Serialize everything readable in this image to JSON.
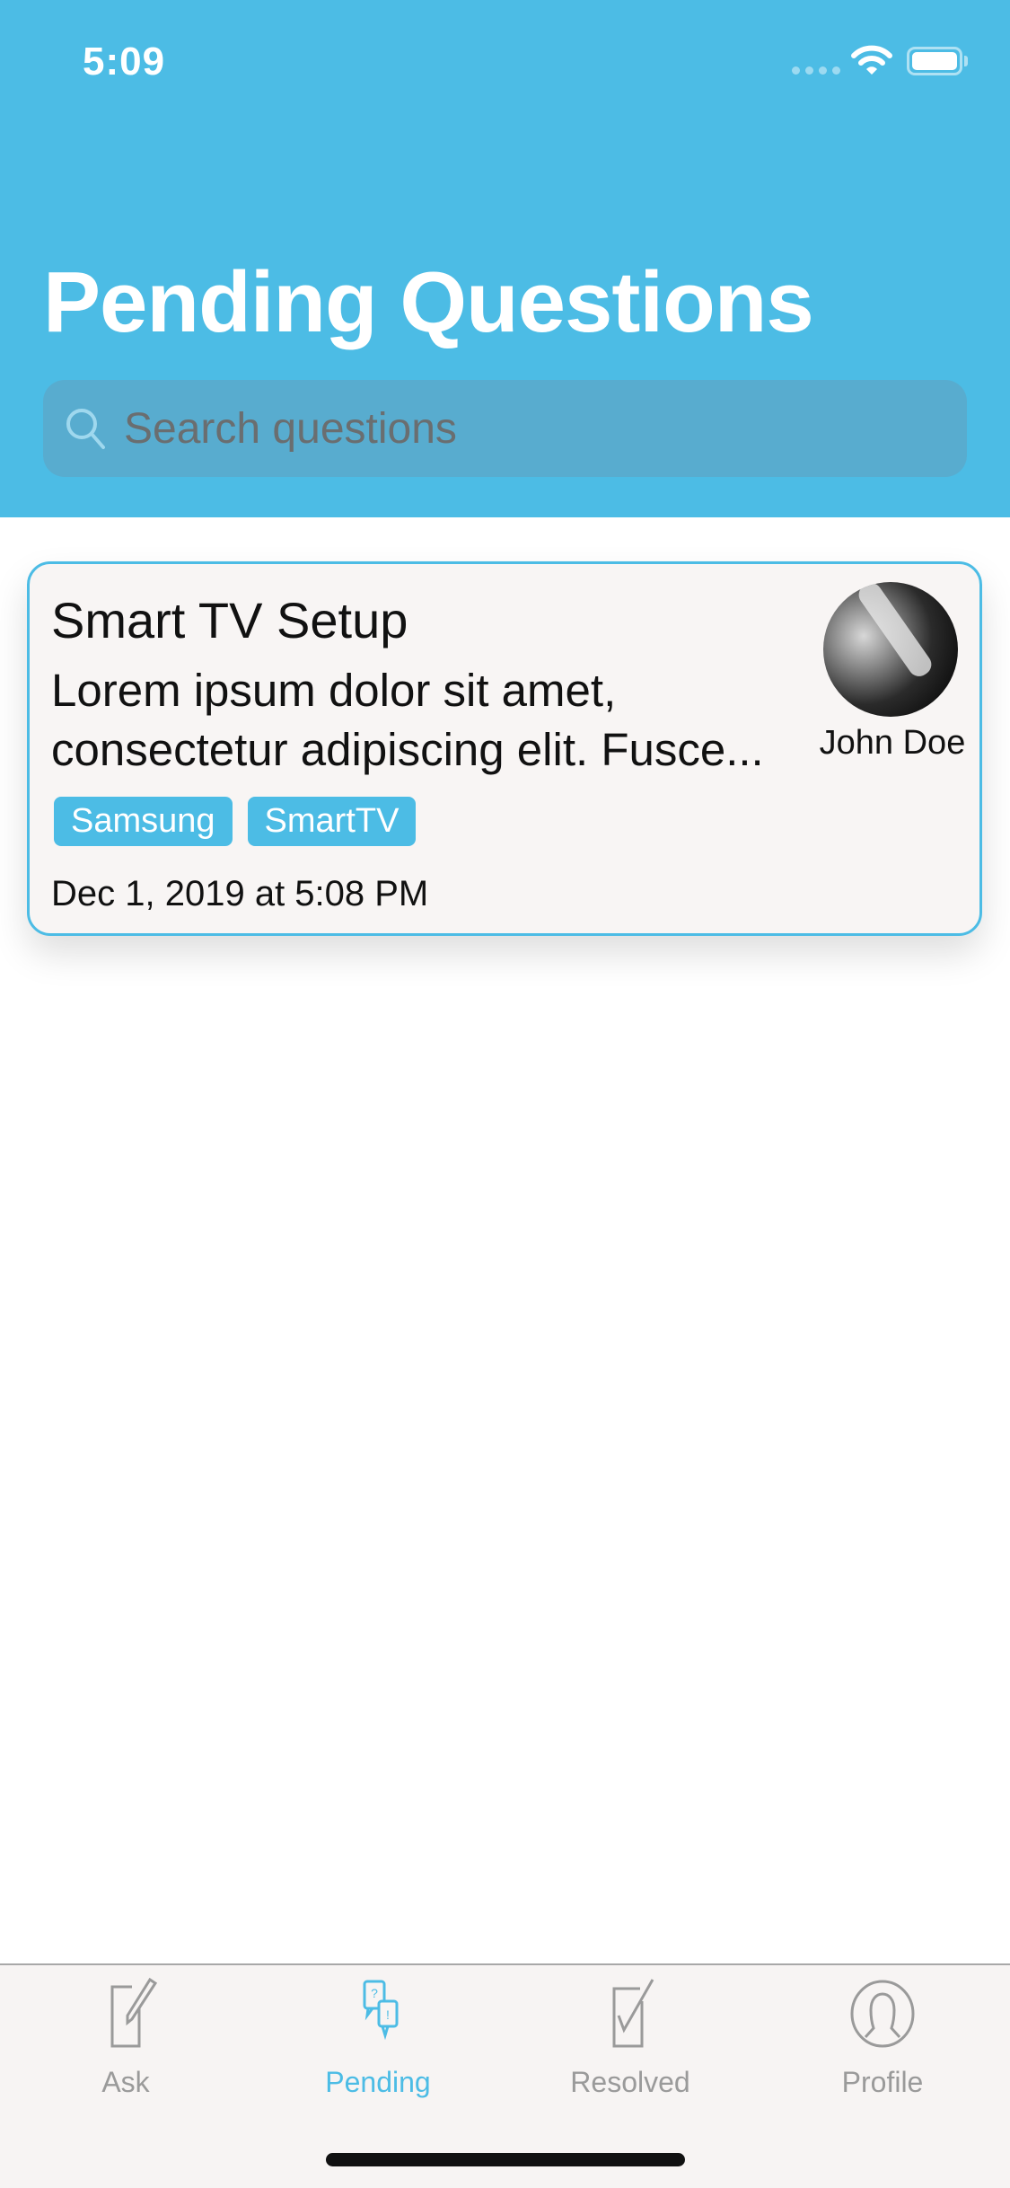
{
  "status_bar": {
    "time": "5:09",
    "icons": [
      "cellular-signal-icon",
      "wifi-icon",
      "battery-icon"
    ]
  },
  "header": {
    "title": "Pending Questions",
    "background_color": "#4cbce5"
  },
  "search": {
    "placeholder": "Search questions",
    "value": "",
    "icon": "search-icon"
  },
  "questions": [
    {
      "title": "Smart TV Setup",
      "body": "Lorem ipsum dolor sit amet, consectetur adipiscing elit. Fusce...",
      "author": "John Doe",
      "tags": [
        "Samsung",
        "SmartTV"
      ],
      "date": "Dec 1, 2019 at 5:08 PM"
    }
  ],
  "tab_bar": {
    "active": "Pending",
    "accent_color": "#4cbce5",
    "tabs": [
      {
        "label": "Ask",
        "icon": "compose-icon"
      },
      {
        "label": "Pending",
        "icon": "chat-question-icon"
      },
      {
        "label": "Resolved",
        "icon": "checkbox-icon"
      },
      {
        "label": "Profile",
        "icon": "profile-icon"
      }
    ]
  }
}
